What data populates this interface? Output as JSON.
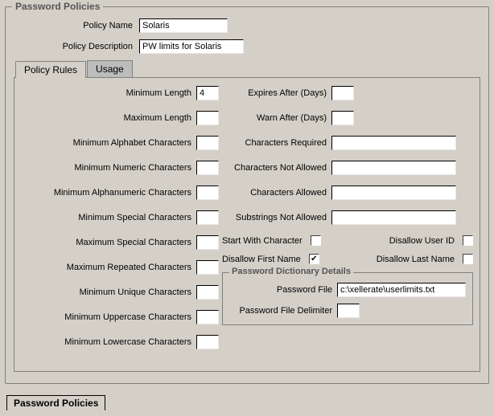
{
  "panel": {
    "title": "Password Policies"
  },
  "header": {
    "policy_name_label": "Policy Name",
    "policy_name_value": "Solaris",
    "policy_desc_label": "Policy Description",
    "policy_desc_value": "PW limits for Solaris"
  },
  "tabs": {
    "rules": "Policy Rules",
    "usage": "Usage"
  },
  "left_fields": {
    "min_length": "Minimum Length",
    "min_length_val": "4",
    "max_length": "Maximum Length",
    "min_alpha": "Minimum Alphabet Characters",
    "min_numeric": "Minimum Numeric Characters",
    "min_alnum": "Minimum Alphanumeric Characters",
    "min_special": "Minimum Special Characters",
    "max_special": "Maximum Special Characters",
    "max_repeated": "Maximum Repeated Characters",
    "min_unique": "Minimum Unique Characters",
    "min_upper": "Minimum Uppercase Characters",
    "min_lower": "Minimum Lowercase Characters"
  },
  "right_fields": {
    "expires_after": "Expires After (Days)",
    "warn_after": "Warn After (Days)",
    "chars_required": "Characters Required",
    "chars_not_allowed": "Characters Not Allowed",
    "chars_allowed": "Characters Allowed",
    "substrings_not_allowed": "Substrings Not Allowed"
  },
  "checks": {
    "start_with_char": "Start With Character",
    "disallow_user_id": "Disallow User ID",
    "disallow_first_name": "Disallow First Name",
    "disallow_last_name": "Disallow Last Name",
    "first_name_checked": "✔"
  },
  "dict": {
    "title": "Password Dictionary Details",
    "file_label": "Password File",
    "file_value": "c:\\xellerate\\userlimits.txt",
    "delim_label": "Password File Delimiter"
  },
  "bottom_tab": "Password Policies"
}
